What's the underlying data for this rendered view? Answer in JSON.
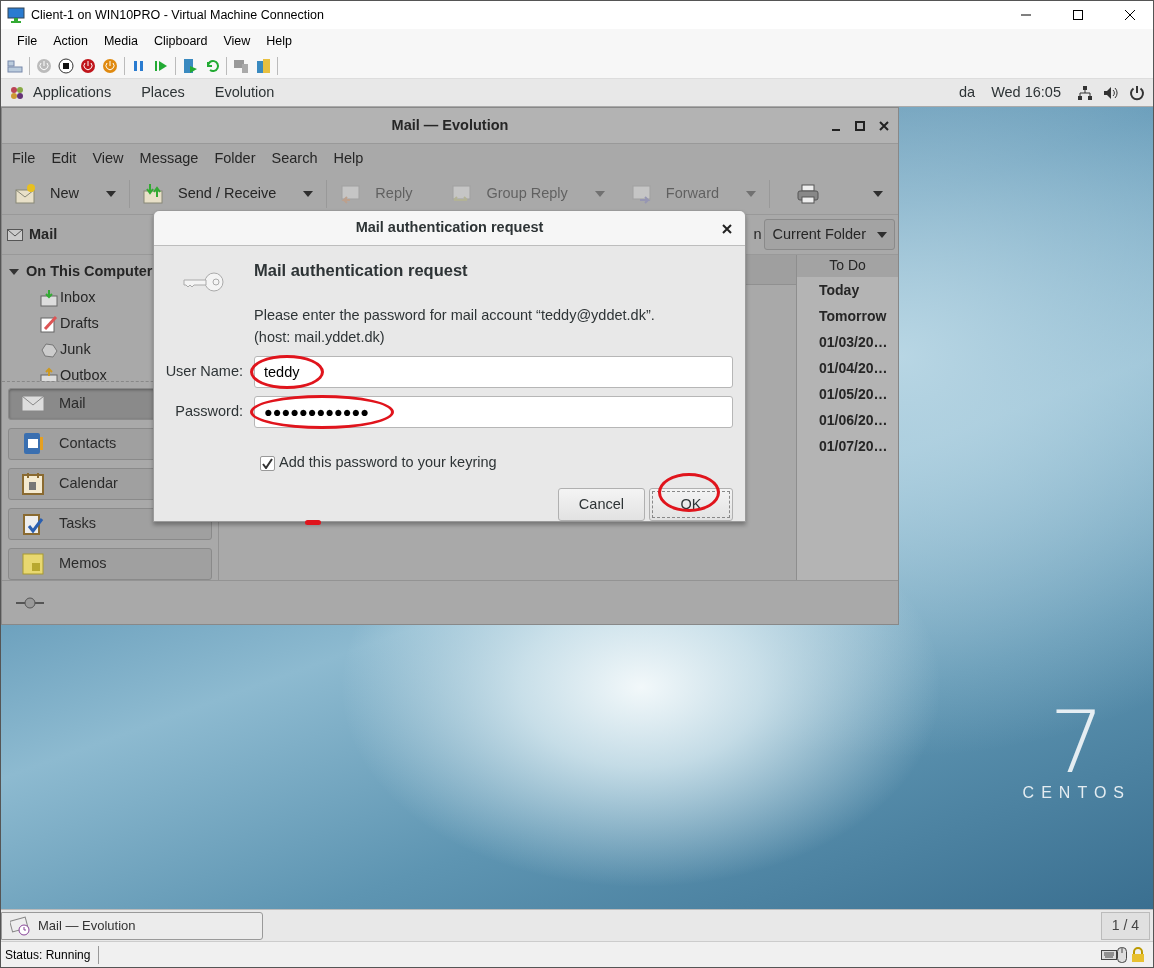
{
  "window": {
    "title": "Client-1 on WIN10PRO - Virtual Machine Connection"
  },
  "menu": [
    "File",
    "Action",
    "Media",
    "Clipboard",
    "View",
    "Help"
  ],
  "gnome_bar": {
    "menus": [
      "Applications",
      "Places",
      "Evolution"
    ],
    "user": "da",
    "clock": "Wed 16:05"
  },
  "evolution": {
    "title": "Mail — Evolution",
    "menu": [
      "File",
      "Edit",
      "View",
      "Message",
      "Folder",
      "Search",
      "Help"
    ],
    "toolbar": [
      {
        "label": "New",
        "kind": "new",
        "disabled": false,
        "dropdown": true
      },
      {
        "label": "Send / Receive",
        "kind": "sendreceive",
        "disabled": false,
        "dropdown": true
      },
      {
        "label": "Reply",
        "kind": "reply",
        "disabled": true,
        "dropdown": false
      },
      {
        "label": "Group Reply",
        "kind": "groupreply",
        "disabled": true,
        "dropdown": true
      },
      {
        "label": "Forward",
        "kind": "forward",
        "disabled": true,
        "dropdown": true
      }
    ],
    "sidebar_title": "Mail",
    "tree": [
      {
        "label": "On This Computer",
        "expanded": true,
        "children": [
          {
            "label": "Inbox",
            "kind": "inbox"
          },
          {
            "label": "Drafts",
            "kind": "drafts"
          },
          {
            "label": "Junk",
            "kind": "junk"
          },
          {
            "label": "Outbox",
            "kind": "outbox"
          }
        ]
      }
    ],
    "switcher": [
      {
        "label": "Mail",
        "kind": "mail",
        "selected": true
      },
      {
        "label": "Contacts",
        "kind": "contacts",
        "selected": false
      },
      {
        "label": "Calendar",
        "kind": "calendar",
        "selected": false
      },
      {
        "label": "Tasks",
        "kind": "tasks",
        "selected": false
      },
      {
        "label": "Memos",
        "kind": "memos",
        "selected": false
      }
    ],
    "search_label_fragment": "n",
    "search_scope": "Current Folder",
    "todo": {
      "title": "To Do",
      "items": [
        "Today",
        "Tomorrow",
        "01/03/20…",
        "01/04/20…",
        "01/05/20…",
        "01/06/20…",
        "01/07/20…"
      ]
    }
  },
  "dialog": {
    "title": "Mail authentication request",
    "heading": "Mail authentication request",
    "message": "Please enter the password for mail account “teddy@yddet.dk”.",
    "host": "(host: mail.yddet.dk)",
    "fields": [
      {
        "label": "User Name:",
        "value": "teddy",
        "circled": true
      },
      {
        "label": "Password:",
        "value": "●●●●●●●●●●●●",
        "circled": true
      }
    ],
    "remember": {
      "label": "Add this password to your keyring",
      "checked": true
    },
    "buttons": [
      {
        "label": "Cancel",
        "default": false,
        "circled": false
      },
      {
        "label": "OK",
        "default": true,
        "circled": true
      }
    ]
  },
  "brand": {
    "numeral": "7",
    "name": "CENTOS"
  },
  "taskbar": {
    "tasks": [
      {
        "label": "Mail — Evolution",
        "selected": false
      }
    ],
    "workspace": "1 / 4"
  },
  "status": "Status: Running"
}
